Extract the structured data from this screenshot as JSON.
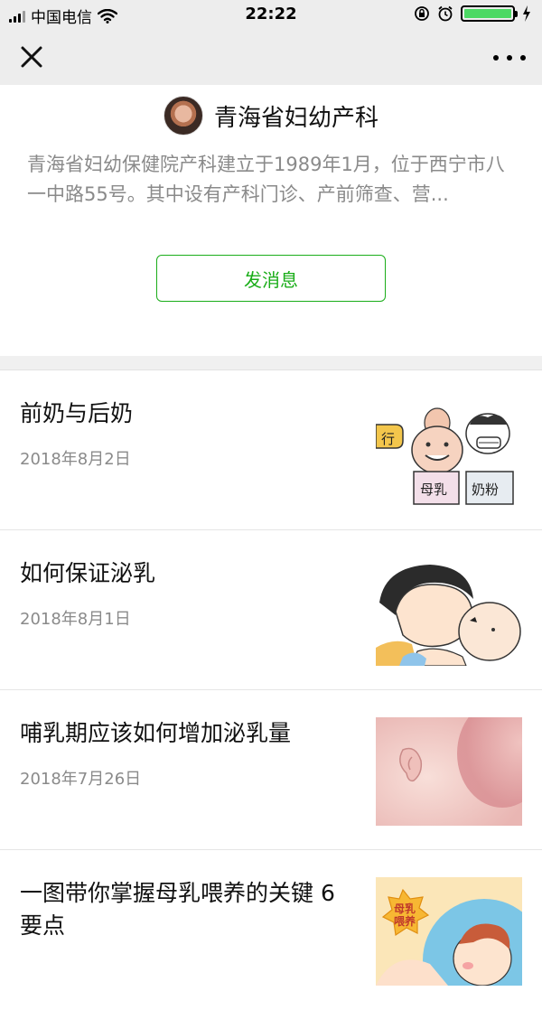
{
  "status_bar": {
    "carrier": "中国电信",
    "time": "22:22"
  },
  "profile": {
    "name": "青海省妇幼产科",
    "description": "青海省妇幼保健院产科建立于1989年1月，位于西宁市八一中路55号。其中设有产科门诊、产前筛查、营...",
    "message_button": "发消息"
  },
  "articles": [
    {
      "title": "前奶与后奶",
      "date": "2018年8月2日",
      "thumb_labels": [
        "行",
        "母乳",
        "奶粉"
      ]
    },
    {
      "title": "如何保证泌乳",
      "date": "2018年8月1日"
    },
    {
      "title": "哺乳期应该如何增加泌乳量",
      "date": "2018年7月26日"
    },
    {
      "title": "一图带你掌握母乳喂养的关键 6 要点",
      "date": "",
      "thumb_labels": [
        "母乳",
        "喂养"
      ]
    }
  ],
  "colors": {
    "accent": "#1aad19",
    "navbar_bg": "#ededed",
    "battery": "#4cd964"
  },
  "icons": [
    "signal-icon",
    "wifi-icon",
    "orientation-lock-icon",
    "alarm-icon",
    "battery-icon",
    "charging-icon",
    "close-icon",
    "more-icon"
  ]
}
